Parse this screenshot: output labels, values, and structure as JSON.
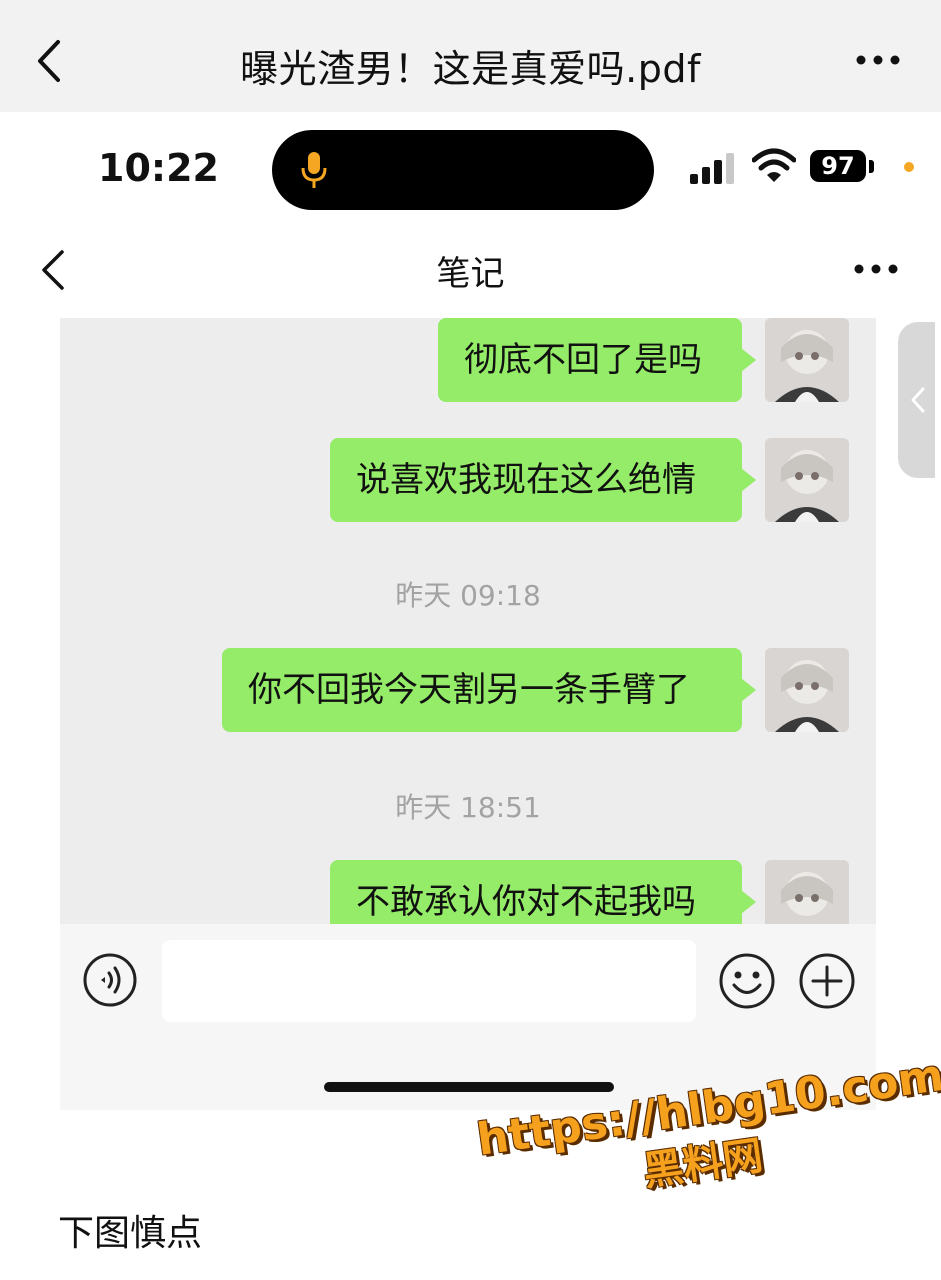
{
  "pdf_viewer": {
    "title": "曝光渣男！这是真爱吗.pdf",
    "icons": {
      "back": "chevron-left-icon",
      "more": "more-horizontal-icon"
    }
  },
  "status_bar": {
    "time": "10:22",
    "battery": "97",
    "icons": {
      "mic": "microphone-icon",
      "signal": "signal-icon",
      "wifi": "wifi-icon"
    }
  },
  "chat_header": {
    "title": "笔记",
    "icons": {
      "back": "chevron-left-icon",
      "more": "more-horizontal-icon"
    }
  },
  "messages": [
    {
      "type": "text",
      "text": "彻底不回了是吗"
    },
    {
      "type": "text",
      "text": "说喜欢我现在这么绝情"
    },
    {
      "type": "timestamp",
      "text": "昨天 09:18"
    },
    {
      "type": "text",
      "text": "你不回我今天割另一条手臂了"
    },
    {
      "type": "timestamp",
      "text": "昨天 18:51"
    },
    {
      "type": "text",
      "text": "不敢承认你对不起我吗"
    }
  ],
  "input_bar": {
    "value": "",
    "icons": {
      "voice": "voice-icon",
      "emoji": "emoji-icon",
      "plus": "plus-circle-icon"
    }
  },
  "watermark": {
    "url": "https://hlbg10.com",
    "label": "黑料网"
  },
  "caption": "下图慎点",
  "colors": {
    "bubble": "#95ec69",
    "chat_background": "#ededed",
    "watermark": "#f6a11e"
  }
}
